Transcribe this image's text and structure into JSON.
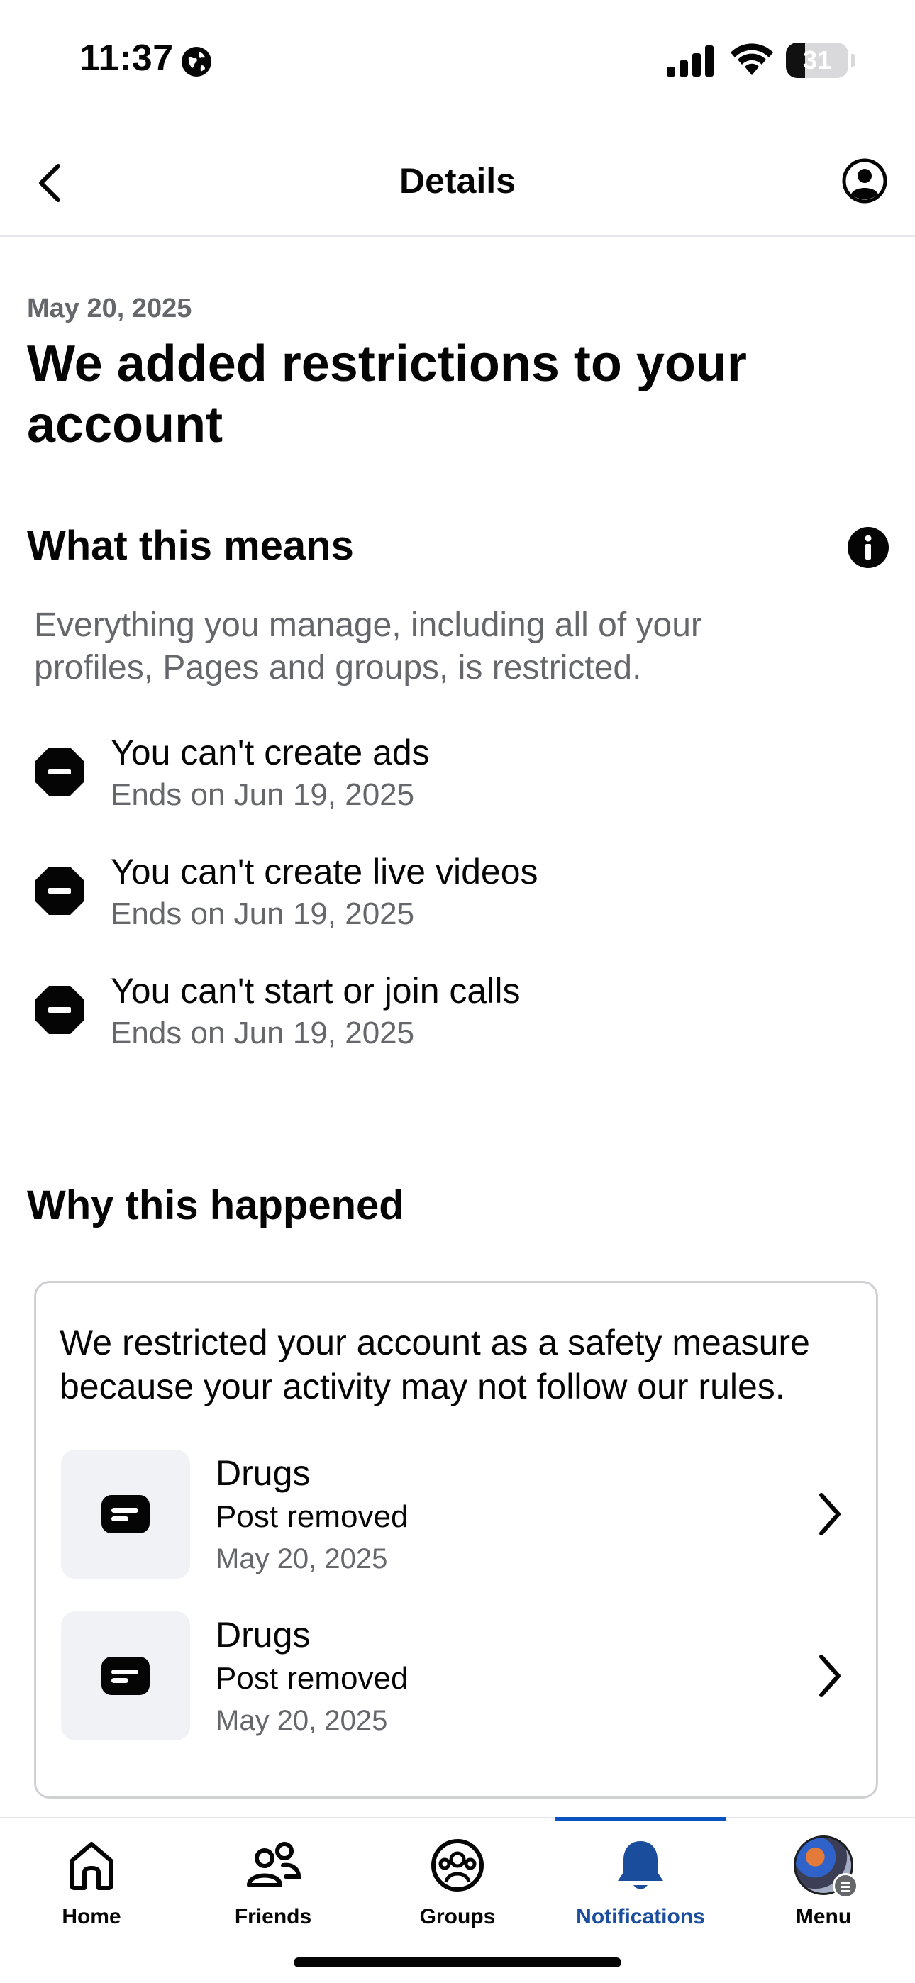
{
  "status_bar": {
    "time": "11:37",
    "battery": "31",
    "battery_level": 0.31
  },
  "nav": {
    "title": "Details",
    "back_icon": "chevron-left-icon",
    "account_icon": "account-circle-icon"
  },
  "notice": {
    "date": "May 20, 2025",
    "headline_line1": "We added restrictions to your",
    "headline_line2": "account"
  },
  "what_this_means": {
    "title": "What this means",
    "description_line1": "Everything you manage, including all of your",
    "description_line2": "profiles, Pages and groups, is restricted.",
    "restrictions": [
      {
        "title": "You can't create ads",
        "ends": "Ends on Jun 19, 2025"
      },
      {
        "title": "You can't create live videos",
        "ends": "Ends on Jun 19, 2025"
      },
      {
        "title": "You can't start or join calls",
        "ends": "Ends on Jun 19, 2025"
      }
    ]
  },
  "why_this_happened": {
    "title": "Why this happened",
    "explanation_line1": "We restricted your account as a safety measure",
    "explanation_line2": "because your activity may not follow our rules.",
    "items": [
      {
        "title": "Drugs",
        "status": "Post removed",
        "date": "May 20, 2025"
      },
      {
        "title": "Drugs",
        "status": "Post removed",
        "date": "May 20, 2025"
      }
    ]
  },
  "tabs": [
    {
      "label": "Home",
      "icon": "home-icon"
    },
    {
      "label": "Friends",
      "icon": "friends-icon"
    },
    {
      "label": "Groups",
      "icon": "groups-icon"
    },
    {
      "label": "Notifications",
      "icon": "bell-icon",
      "active": true
    },
    {
      "label": "Menu",
      "icon": "avatar"
    }
  ],
  "colors": {
    "accent": "#1a4d9c",
    "secondary_text": "#65676b",
    "divider": "#e4e6eb"
  }
}
